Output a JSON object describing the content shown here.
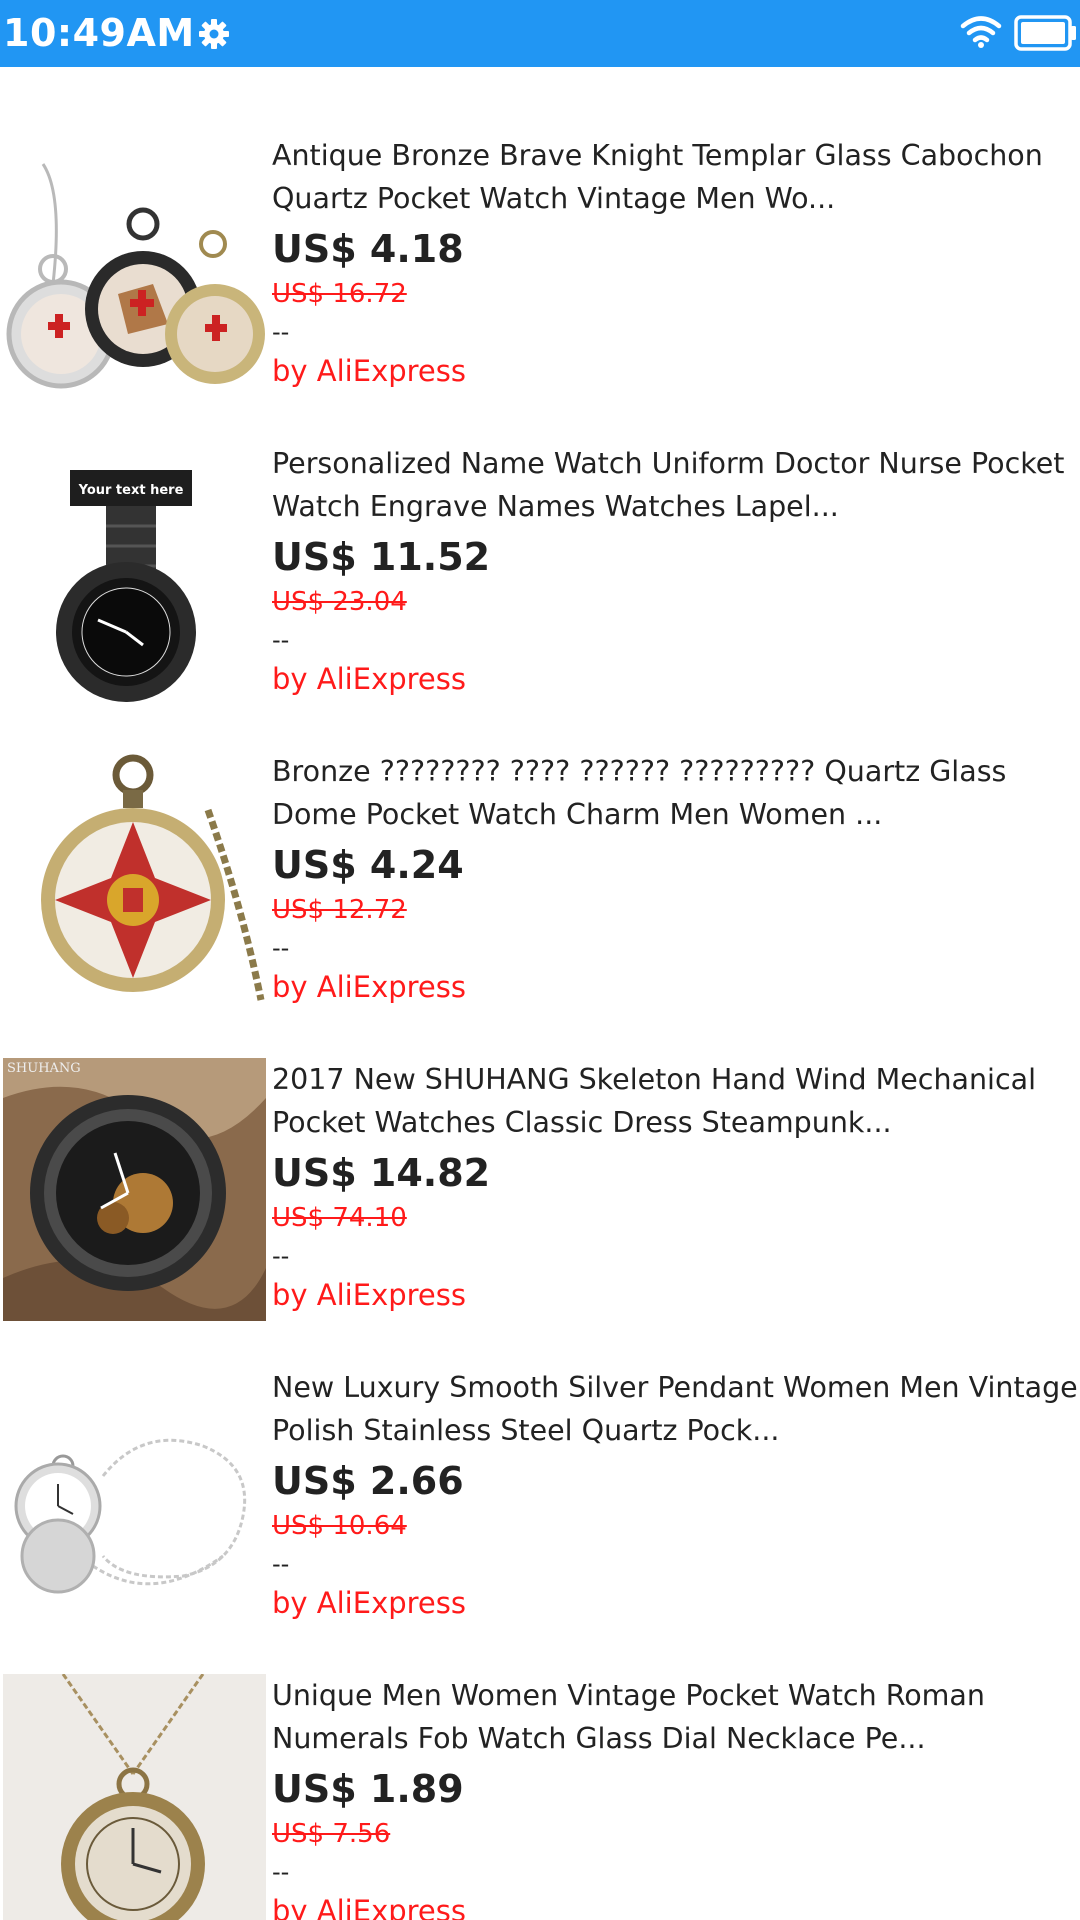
{
  "status_bar": {
    "time": "10:49AM",
    "icons": [
      "gear-icon",
      "wifi-icon",
      "battery-icon"
    ],
    "color": "#2196f3"
  },
  "colors": {
    "price": "#222222",
    "original_price": "#ff1a1a",
    "seller": "#ff1a1a"
  },
  "products": [
    {
      "title": "Antique Bronze Brave Knight Templar Glass Cabochon Quartz Pocket Watch Vintage Men Wo...",
      "price": "US$ 4.18",
      "original_price": "US$ 16.72",
      "rating": "--",
      "seller": "by AliExpress",
      "image": "three-templar-pocket-watches"
    },
    {
      "title": "Personalized Name Watch Uniform Doctor Nurse Pocket Watch Engrave Names Watches Lapel...",
      "price": "US$ 11.52",
      "original_price": "US$ 23.04",
      "rating": "--",
      "seller": "by AliExpress",
      "image": "black-nurse-fob-watch",
      "image_caption": "Your text here"
    },
    {
      "title": "Bronze ???????? ???? ?????? ????????? Quartz Glass Dome Pocket Watch Charm Men Women ...",
      "price": "US$ 4.24",
      "original_price": "US$ 12.72",
      "rating": "--",
      "seller": "by AliExpress",
      "image": "bronze-eagle-cross-pocket-watch"
    },
    {
      "title": "2017 New SHUHANG Skeleton Hand Wind Mechanical Pocket Watches Classic Dress Steampunk...",
      "price": "US$ 14.82",
      "original_price": "US$ 74.10",
      "rating": "--",
      "seller": "by AliExpress",
      "image": "skeleton-mechanical-pocket-watch",
      "image_caption": "SHUHANG"
    },
    {
      "title": "New Luxury Smooth Silver Pendant Women Men Vintage Polish Stainless Steel Quartz Pock...",
      "price": "US$ 2.66",
      "original_price": "US$ 10.64",
      "rating": "--",
      "seller": "by AliExpress",
      "image": "silver-pocket-watch-chain"
    },
    {
      "title": "Unique Men Women Vintage Pocket Watch Roman Numerals Fob Watch Glass Dial Necklace Pe...",
      "price": "US$ 1.89",
      "original_price": "US$ 7.56",
      "rating": "--",
      "seller": "by AliExpress",
      "image": "roman-numeral-necklace-watch"
    }
  ]
}
